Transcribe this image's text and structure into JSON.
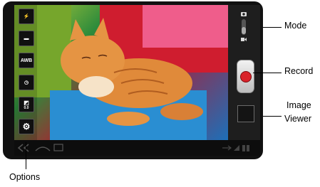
{
  "camera_controls": {
    "flash_icon_label": "⚡",
    "shooting_mode_icon_label": "▬",
    "white_balance_label": "AWB",
    "timer_icon_label": "◷",
    "exposure_label": "0.0",
    "settings_icon_label": "⚙"
  },
  "callouts": {
    "mode": "Mode",
    "record": "Record",
    "image_viewer_line1": "Image",
    "image_viewer_line2": "Viewer",
    "options": "Options"
  },
  "colors": {
    "record_red": "#d9232a",
    "panel": "#1e1e1e"
  },
  "icons": {
    "flash": "flash-icon",
    "shooting_mode": "camera-mode-icon",
    "white_balance": "awb-icon",
    "timer": "timer-icon",
    "exposure": "exposure-icon",
    "settings": "gear-icon",
    "mode_camera": "camera-icon",
    "mode_video": "video-icon",
    "nav_back": "back-icon",
    "nav_home": "home-icon",
    "nav_recent": "recent-apps-icon"
  }
}
